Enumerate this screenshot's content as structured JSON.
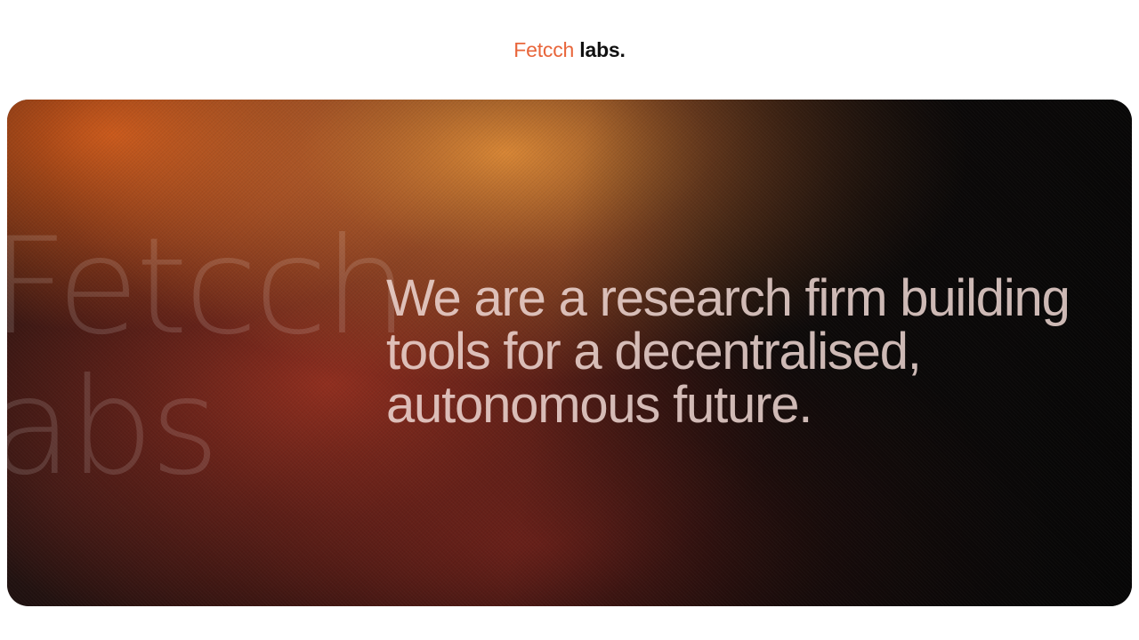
{
  "header": {
    "logo": {
      "brand": "Fetcch",
      "suffix": "labs."
    }
  },
  "hero": {
    "watermark": {
      "line1": "Fetcch",
      "line2": "labs"
    },
    "tagline": "We are a research firm building tools for a decentralised, autonomous future."
  },
  "colors": {
    "brand_accent": "#e8653a",
    "logo_text": "#111111",
    "page_background": "#ffffff",
    "hero_dark": "#120c0b",
    "hero_orange": "#e28c37",
    "hero_rust": "#96301f",
    "tagline_text": "#eed6d2"
  }
}
